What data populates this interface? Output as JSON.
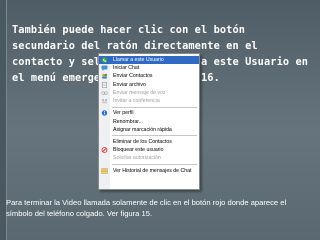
{
  "slide": {
    "heading": "También puede hacer clic con el botón secundario del ratón directamente en el contacto y seleccionar Llamar a este Usuario en el menú emergente. Ver figura 16.",
    "caption": "Para terminar la Video llamada solamente de clic en el botón rojo donde aparece el símbolo del teléfono colgado. Ver figura 15."
  },
  "context_menu": {
    "items": [
      {
        "label": "Llamar a este Usuario",
        "icon": "phone-icon",
        "state": "highlighted"
      },
      {
        "label": "Iniciar Chat",
        "icon": "chat-icon",
        "state": "normal"
      },
      {
        "label": "Enviar Contactos",
        "icon": "contacts-icon",
        "state": "normal"
      },
      {
        "label": "Enviar archivo",
        "icon": "file-icon",
        "state": "normal"
      },
      {
        "label": "Enviar mensaje de voz",
        "icon": "voicemail-icon",
        "state": "disabled"
      },
      {
        "label": "Invitar a conferencia",
        "icon": "conference-icon",
        "state": "disabled"
      },
      {
        "label": "Ver perfil",
        "icon": "info-icon",
        "state": "normal"
      },
      {
        "label": "Renombrar...",
        "icon": "",
        "state": "normal"
      },
      {
        "label": "Asignar marcación rápida",
        "icon": "",
        "state": "normal"
      },
      {
        "label": "Eliminar de los Contactos",
        "icon": "",
        "state": "normal"
      },
      {
        "label": "Bloquear este usuario",
        "icon": "block-icon",
        "state": "normal"
      },
      {
        "label": "Solicitar autorización",
        "icon": "",
        "state": "disabled"
      },
      {
        "label": "Ver Historial de mensajes de Chat",
        "icon": "history-icon",
        "state": "normal"
      }
    ]
  },
  "colors": {
    "background": "#5c6b73",
    "text": "#ffffff",
    "menu_highlight": "#316ac5"
  }
}
